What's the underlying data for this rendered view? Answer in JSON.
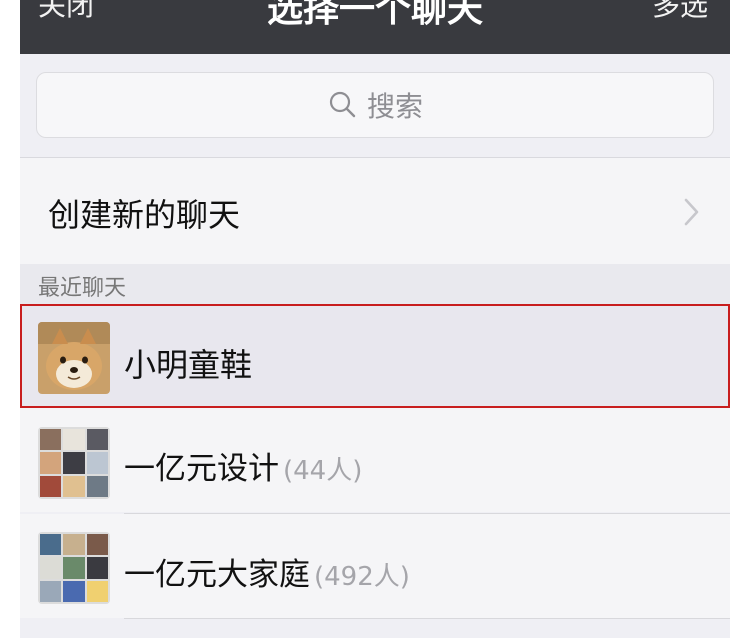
{
  "header": {
    "left_label": "关闭",
    "title": "选择一个聊天",
    "right_label": "多选",
    "background": "#393a3f"
  },
  "search": {
    "placeholder": "搜索",
    "icon": "search-icon"
  },
  "create_new": {
    "label": "创建新的聊天",
    "icon": "chevron-right-icon"
  },
  "recent": {
    "section_title": "最近聊天",
    "items": [
      {
        "name": "小明童鞋",
        "count": "",
        "avatar": "shiba-dog-avatar",
        "selected": true
      },
      {
        "name": "一亿元设计",
        "count": "(44人)",
        "avatar": "group-avatar"
      },
      {
        "name": "一亿元大家庭",
        "count": "(492人)",
        "avatar": "group-avatar"
      }
    ]
  },
  "colors": {
    "selection_outline": "#c81e1e",
    "muted_text": "#a5a5aa",
    "page_background": "#efeff4"
  }
}
